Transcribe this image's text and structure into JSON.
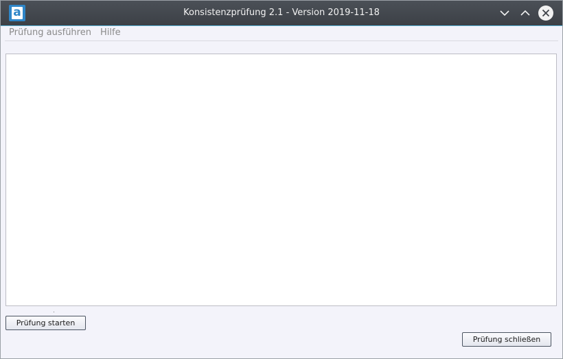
{
  "window": {
    "title": "Konsistenzprüfung 2.1 - Version 2019-11-18",
    "app_icon_letter": "a",
    "controls": {
      "minimize_icon": "chevron-down-icon",
      "maximize_icon": "chevron-up-icon",
      "close_icon": "close-icon"
    }
  },
  "menubar": {
    "items": [
      {
        "label": "Prüfung ausführen"
      },
      {
        "label": "Hilfe"
      }
    ]
  },
  "output": {
    "text": ""
  },
  "buttons": {
    "start_label": "Prüfung starten",
    "close_label": "Prüfung schließen"
  },
  "colors": {
    "titlebar": "#3f4349",
    "accent": "#5ab4d8",
    "app_icon": "#2f86c8",
    "window_bg": "#f3f3fa",
    "menu_text_disabled": "#8a8a8a"
  }
}
